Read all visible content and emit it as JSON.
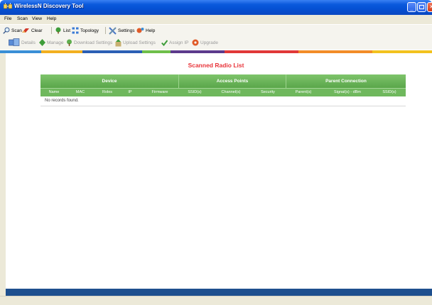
{
  "window": {
    "title": "WirelessN Discovery Tool",
    "minimize_glyph": "",
    "maximize_glyph": "",
    "close_glyph": ""
  },
  "menu": {
    "items": [
      "File",
      "Scan",
      "View",
      "Help"
    ]
  },
  "toolbar": {
    "items": [
      {
        "label": "Scan",
        "icon": "magnifier-icon"
      },
      {
        "label": "Clear",
        "icon": "eraser-icon"
      },
      {
        "label": "List",
        "icon": "tree-icon"
      },
      {
        "label": "Topology",
        "icon": "topology-icon"
      },
      {
        "label": "Settings",
        "icon": "tools-icon"
      },
      {
        "label": "Help",
        "icon": "help-icon"
      }
    ]
  },
  "actions": {
    "items": [
      {
        "label": "Details",
        "icon": "details-icon",
        "enabled": false
      },
      {
        "label": "Manage",
        "icon": "manage-icon",
        "enabled": false
      },
      {
        "label": "Download Settings",
        "icon": "download-icon",
        "enabled": false
      },
      {
        "label": "Upload Settings",
        "icon": "upload-icon",
        "enabled": false
      },
      {
        "label": "Assign IP",
        "icon": "checkmark-icon",
        "enabled": false
      },
      {
        "label": "Upgrade",
        "icon": "upgrade-icon",
        "enabled": false
      }
    ]
  },
  "stripe_colors": [
    "#3a8fd6",
    "#f2b020",
    "#2b5fb4",
    "#6fbf4a",
    "#5c3a8c",
    "#e03838",
    "#f28c28",
    "#f2c21e"
  ],
  "content": {
    "heading": "Scanned Radio List"
  },
  "grid": {
    "groups": [
      "Device",
      "Access Points",
      "Parent Connection"
    ],
    "columns": [
      "Name",
      "MAC",
      "Roles",
      "IP",
      "Firmware",
      "SSID(s)",
      "Channel(s)",
      "Security",
      "Parent(s)",
      "Signal(s) - dBm",
      "SSID(s)"
    ],
    "empty_text": "No records found."
  },
  "colors": {
    "accent_heading": "#e8343a",
    "grid_header": "#6fb85d"
  }
}
